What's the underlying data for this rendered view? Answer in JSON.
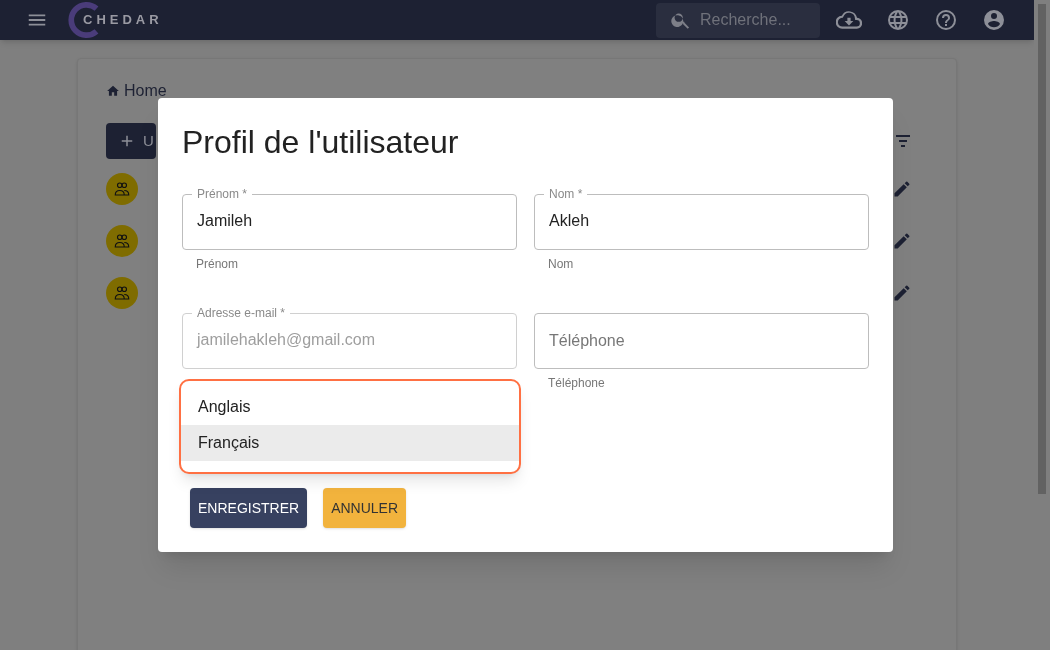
{
  "header": {
    "logo": "CHEDAR",
    "search": {
      "placeholder": "Recherche..."
    }
  },
  "page": {
    "breadcrumb": "Home",
    "add_button": "U",
    "rows": [
      {
        "kind": "user"
      },
      {
        "kind": "user"
      },
      {
        "kind": "user"
      }
    ]
  },
  "dialog": {
    "title": "Profil de l'utilisateur",
    "fields": [
      {
        "label": "Prénom *",
        "value": "Jamileh",
        "helper": "Prénom"
      },
      {
        "label": "Nom *",
        "value": "Akleh",
        "helper": "Nom"
      },
      {
        "label": "Adresse e-mail *",
        "value": "jamilehakleh@gmail.com",
        "disabled": true
      },
      {
        "placeholder": "Téléphone",
        "helper": "Téléphone"
      }
    ],
    "language_menu": [
      {
        "label": "Anglais",
        "selected": false
      },
      {
        "label": "Français",
        "selected": true
      }
    ],
    "buttons": [
      {
        "label": "ENREGISTRER",
        "kind": "primary"
      },
      {
        "label": "ANNULER",
        "kind": "secondary"
      }
    ]
  }
}
